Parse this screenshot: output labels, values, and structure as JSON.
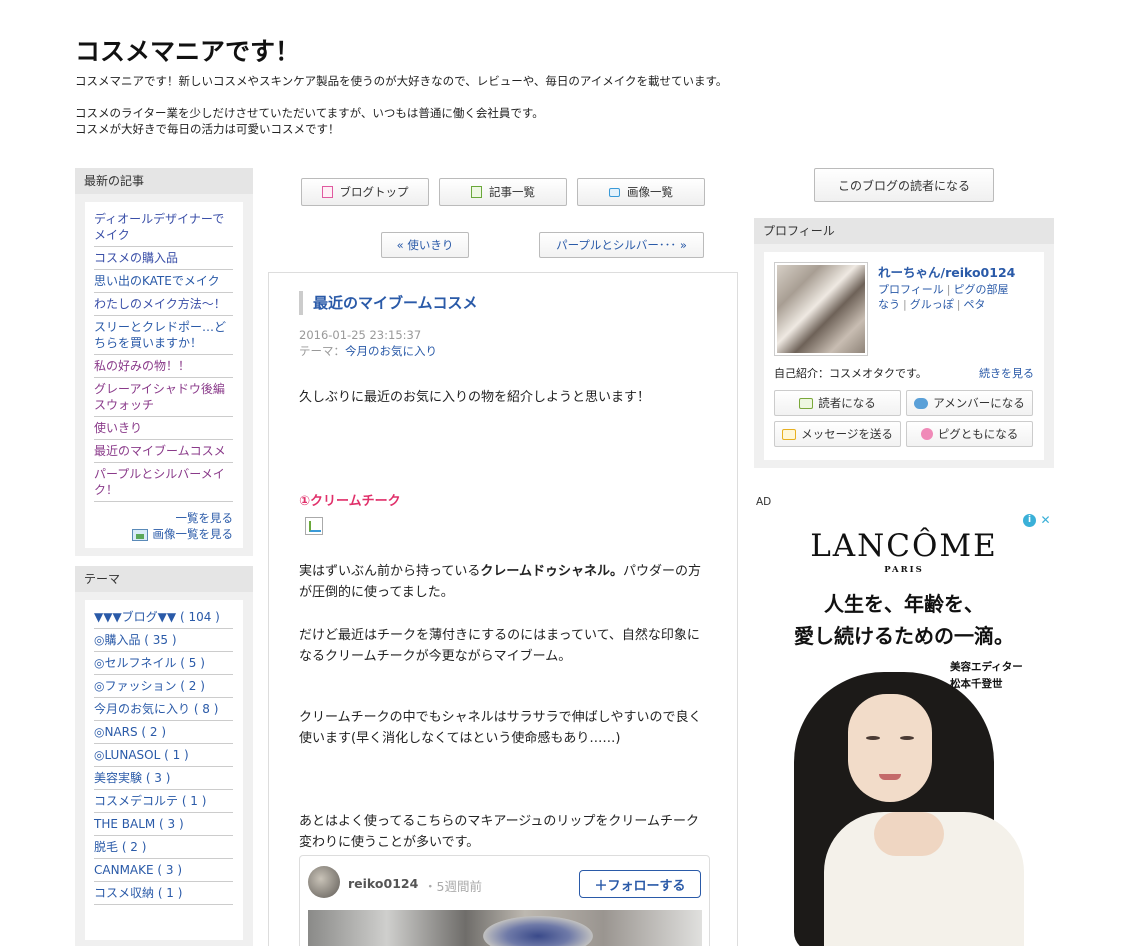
{
  "header": {
    "title": "コスメマニアです！",
    "description": "コスメマニアです！新しいコスメやスキンケア製品を使うのが大好きなので、レビューや、毎日のアイメイクを載せています。\n\nコスメのライター業を少しだけさせていただいてますが、いつもは普通に働く会社員です。\nコスメが大好きで毎日の活力は可愛いコスメです！"
  },
  "recent": {
    "heading": "最新の記事",
    "items": [
      "ディオールデザイナーでメイク",
      "コスメの購入品",
      "思い出のKATEでメイク",
      "わたしのメイク方法〜！",
      "スリーとクレドポー…どちらを買いますか！",
      "私の好みの物！！",
      "グレーアイシャドウ後編スウォッチ",
      "使いきり",
      "最近のマイブームコスメ",
      "パープルとシルバーメイク！"
    ],
    "more_label": "一覧を見る",
    "images_label": "画像一覧を見る"
  },
  "theme": {
    "heading": "テーマ",
    "items": [
      "▼▼▼ブログ▼▼ ( 104 )",
      "◎購入品 ( 35 )",
      "◎セルフネイル ( 5 )",
      "◎ファッション ( 2 )",
      "今月のお気に入り ( 8 )",
      "◎NARS ( 2 )",
      "◎LUNASOL ( 1 )",
      "美容実験 ( 3 )",
      "コスメデコルテ ( 1 )",
      "THE BALM ( 3 )",
      "脱毛 ( 2 )",
      "CANMAKE ( 3 )",
      "コスメ収納 ( 1 )"
    ]
  },
  "nav": {
    "top": "ブログトップ",
    "list": "記事一覧",
    "images": "画像一覧",
    "prev": "« 使いきり",
    "next": "パープルとシルバー･･･ »"
  },
  "article": {
    "title": "最近のマイブームコスメ",
    "datetime": "2016-01-25 23:15:37",
    "theme_prefix": "テーマ：",
    "theme_link": "今月のお気に入り",
    "intro": "久しぶりに最近のお気に入りの物を紹介しようと思います！",
    "section1": "①クリームチーク",
    "para1_a": "実はずいぶん前から持っている",
    "para1_bold": "クレームドゥシャネル。",
    "para1_b": "パウダーの方が圧倒的に使ってました。",
    "para2": "だけど最近はチークを薄付きにするのにはまっていて、自然な印象になるクリームチークが今更ながらマイブーム。",
    "para3": "クリームチークの中でもシャネルはサラサラで伸ばしやすいので良く使います(早く消化しなくてはという使命感もあり……)",
    "para4": "あとはよく使ってるこちらのマキアージュのリップをクリームチーク変わりに使うことが多いです。",
    "embed": {
      "user": "reiko0124",
      "time": "5週間前",
      "follow": "＋フォローする"
    }
  },
  "sidebar_right": {
    "reader_button": "このブログの読者になる",
    "profile_heading": "プロフィール",
    "profile_name": "れーちゃん/reiko0124",
    "profile_links": [
      "プロフィール",
      "ピグの部屋",
      "なう",
      "グルっぽ",
      "ペタ"
    ],
    "profile_intro": "自己紹介：コスメオタクです。",
    "profile_more": "続きを見る",
    "buttons": {
      "reader": "読者になる",
      "amember": "アメンバーになる",
      "message": "メッセージを送る",
      "pigfriend": "ピグともになる"
    }
  },
  "ad": {
    "label": "AD",
    "brand": "LANCÔME",
    "brand_sub": "PARIS",
    "copy": "人生を、年齢を、\n愛し続けるための一滴。",
    "credit": "美容エディター\n松本千登世"
  }
}
